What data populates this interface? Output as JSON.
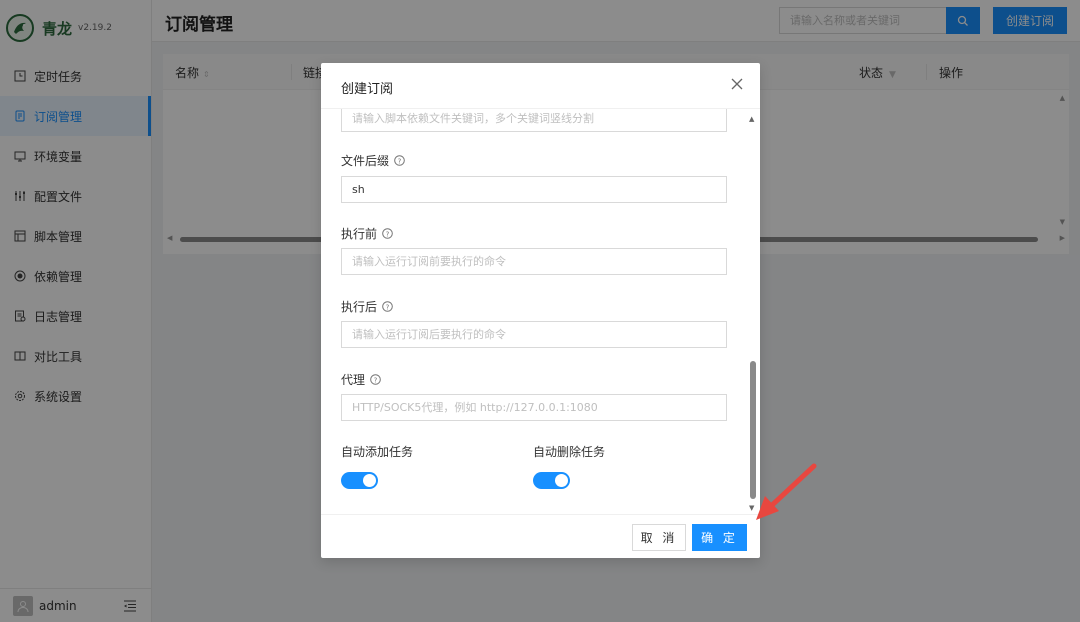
{
  "brand": {
    "name": "青龙",
    "version": "v2.19.2"
  },
  "sidebar": {
    "items": [
      {
        "label": "定时任务",
        "icon": "clock-icon"
      },
      {
        "label": "订阅管理",
        "icon": "subscription-icon",
        "active": true
      },
      {
        "label": "环境变量",
        "icon": "monitor-icon"
      },
      {
        "label": "配置文件",
        "icon": "sliders-icon"
      },
      {
        "label": "脚本管理",
        "icon": "script-icon"
      },
      {
        "label": "依赖管理",
        "icon": "dependency-icon"
      },
      {
        "label": "日志管理",
        "icon": "log-icon"
      },
      {
        "label": "对比工具",
        "icon": "diff-icon"
      },
      {
        "label": "系统设置",
        "icon": "gear-icon"
      }
    ],
    "footer": {
      "username": "admin"
    }
  },
  "header": {
    "title": "订阅管理",
    "search_placeholder": "请输入名称或者关键词",
    "create_label": "创建订阅"
  },
  "table": {
    "columns": [
      "名称",
      "链接",
      "状态",
      "操作"
    ]
  },
  "modal": {
    "title": "创建订阅",
    "dependency_placeholder": "请输入脚本依赖文件关键词，多个关键词竖线分割",
    "extensions": {
      "label": "文件后缀",
      "value": "sh"
    },
    "before": {
      "label": "执行前",
      "placeholder": "请输入运行订阅前要执行的命令"
    },
    "after": {
      "label": "执行后",
      "placeholder": "请输入运行订阅后要执行的命令"
    },
    "proxy": {
      "label": "代理",
      "placeholder": "HTTP/SOCK5代理，例如 http://127.0.0.1:1080"
    },
    "auto_add": {
      "label": "自动添加任务",
      "enabled": true
    },
    "auto_delete": {
      "label": "自动删除任务",
      "enabled": true
    },
    "cancel_label": "取 消",
    "ok_label": "确 定"
  },
  "colors": {
    "primary": "#1890ff",
    "brand": "#2e6a3f",
    "annotation_arrow": "#e8473f"
  }
}
